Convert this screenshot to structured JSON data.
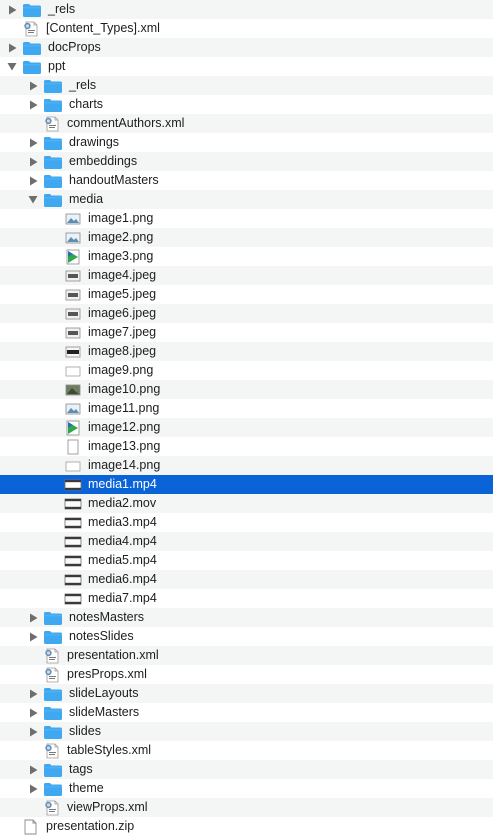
{
  "colors": {
    "folder": "#3fa8f0",
    "folder_tab": "#5fb9f7",
    "selection": "#0b63d8",
    "alt_row": "#f4f5f5",
    "disclosure": "#6e6e6e"
  },
  "rows": [
    {
      "name": "_rels",
      "type": "folder",
      "level": 0,
      "disclosure": "collapsed"
    },
    {
      "name": "[Content_Types].xml",
      "type": "xml",
      "level": 0,
      "disclosure": "none"
    },
    {
      "name": "docProps",
      "type": "folder",
      "level": 0,
      "disclosure": "collapsed"
    },
    {
      "name": "ppt",
      "type": "folder",
      "level": 0,
      "disclosure": "expanded"
    },
    {
      "name": "_rels",
      "type": "folder",
      "level": 1,
      "disclosure": "collapsed"
    },
    {
      "name": "charts",
      "type": "folder",
      "level": 1,
      "disclosure": "collapsed"
    },
    {
      "name": "commentAuthors.xml",
      "type": "xml",
      "level": 1,
      "disclosure": "none"
    },
    {
      "name": "drawings",
      "type": "folder",
      "level": 1,
      "disclosure": "collapsed"
    },
    {
      "name": "embeddings",
      "type": "folder",
      "level": 1,
      "disclosure": "collapsed"
    },
    {
      "name": "handoutMasters",
      "type": "folder",
      "level": 1,
      "disclosure": "collapsed"
    },
    {
      "name": "media",
      "type": "folder",
      "level": 1,
      "disclosure": "expanded"
    },
    {
      "name": "image1.png",
      "type": "image",
      "level": 2,
      "disclosure": "none",
      "thumb": "landscape"
    },
    {
      "name": "image2.png",
      "type": "image",
      "level": 2,
      "disclosure": "none",
      "thumb": "landscape"
    },
    {
      "name": "image3.png",
      "type": "image",
      "level": 2,
      "disclosure": "none",
      "thumb": "green"
    },
    {
      "name": "image4.jpeg",
      "type": "image",
      "level": 2,
      "disclosure": "none",
      "thumb": "dark"
    },
    {
      "name": "image5.jpeg",
      "type": "image",
      "level": 2,
      "disclosure": "none",
      "thumb": "dark"
    },
    {
      "name": "image6.jpeg",
      "type": "image",
      "level": 2,
      "disclosure": "none",
      "thumb": "dark"
    },
    {
      "name": "image7.jpeg",
      "type": "image",
      "level": 2,
      "disclosure": "none",
      "thumb": "dark"
    },
    {
      "name": "image8.jpeg",
      "type": "image",
      "level": 2,
      "disclosure": "none",
      "thumb": "black"
    },
    {
      "name": "image9.png",
      "type": "image",
      "level": 2,
      "disclosure": "none",
      "thumb": "blank"
    },
    {
      "name": "image10.png",
      "type": "image",
      "level": 2,
      "disclosure": "none",
      "thumb": "photo"
    },
    {
      "name": "image11.png",
      "type": "image",
      "level": 2,
      "disclosure": "none",
      "thumb": "landscape"
    },
    {
      "name": "image12.png",
      "type": "image",
      "level": 2,
      "disclosure": "none",
      "thumb": "green"
    },
    {
      "name": "image13.png",
      "type": "image",
      "level": 2,
      "disclosure": "none",
      "thumb": "page"
    },
    {
      "name": "image14.png",
      "type": "image",
      "level": 2,
      "disclosure": "none",
      "thumb": "blank"
    },
    {
      "name": "media1.mp4",
      "type": "video",
      "level": 2,
      "disclosure": "none",
      "selected": true
    },
    {
      "name": "media2.mov",
      "type": "video",
      "level": 2,
      "disclosure": "none"
    },
    {
      "name": "media3.mp4",
      "type": "video",
      "level": 2,
      "disclosure": "none"
    },
    {
      "name": "media4.mp4",
      "type": "video",
      "level": 2,
      "disclosure": "none"
    },
    {
      "name": "media5.mp4",
      "type": "video",
      "level": 2,
      "disclosure": "none"
    },
    {
      "name": "media6.mp4",
      "type": "video",
      "level": 2,
      "disclosure": "none"
    },
    {
      "name": "media7.mp4",
      "type": "video",
      "level": 2,
      "disclosure": "none"
    },
    {
      "name": "notesMasters",
      "type": "folder",
      "level": 1,
      "disclosure": "collapsed"
    },
    {
      "name": "notesSlides",
      "type": "folder",
      "level": 1,
      "disclosure": "collapsed"
    },
    {
      "name": "presentation.xml",
      "type": "xml",
      "level": 1,
      "disclosure": "none"
    },
    {
      "name": "presProps.xml",
      "type": "xml",
      "level": 1,
      "disclosure": "none"
    },
    {
      "name": "slideLayouts",
      "type": "folder",
      "level": 1,
      "disclosure": "collapsed"
    },
    {
      "name": "slideMasters",
      "type": "folder",
      "level": 1,
      "disclosure": "collapsed"
    },
    {
      "name": "slides",
      "type": "folder",
      "level": 1,
      "disclosure": "collapsed"
    },
    {
      "name": "tableStyles.xml",
      "type": "xml",
      "level": 1,
      "disclosure": "none"
    },
    {
      "name": "tags",
      "type": "folder",
      "level": 1,
      "disclosure": "collapsed"
    },
    {
      "name": "theme",
      "type": "folder",
      "level": 1,
      "disclosure": "collapsed"
    },
    {
      "name": "viewProps.xml",
      "type": "xml",
      "level": 1,
      "disclosure": "none"
    },
    {
      "name": "presentation.zip",
      "type": "document",
      "level": 0,
      "disclosure": "none"
    }
  ]
}
